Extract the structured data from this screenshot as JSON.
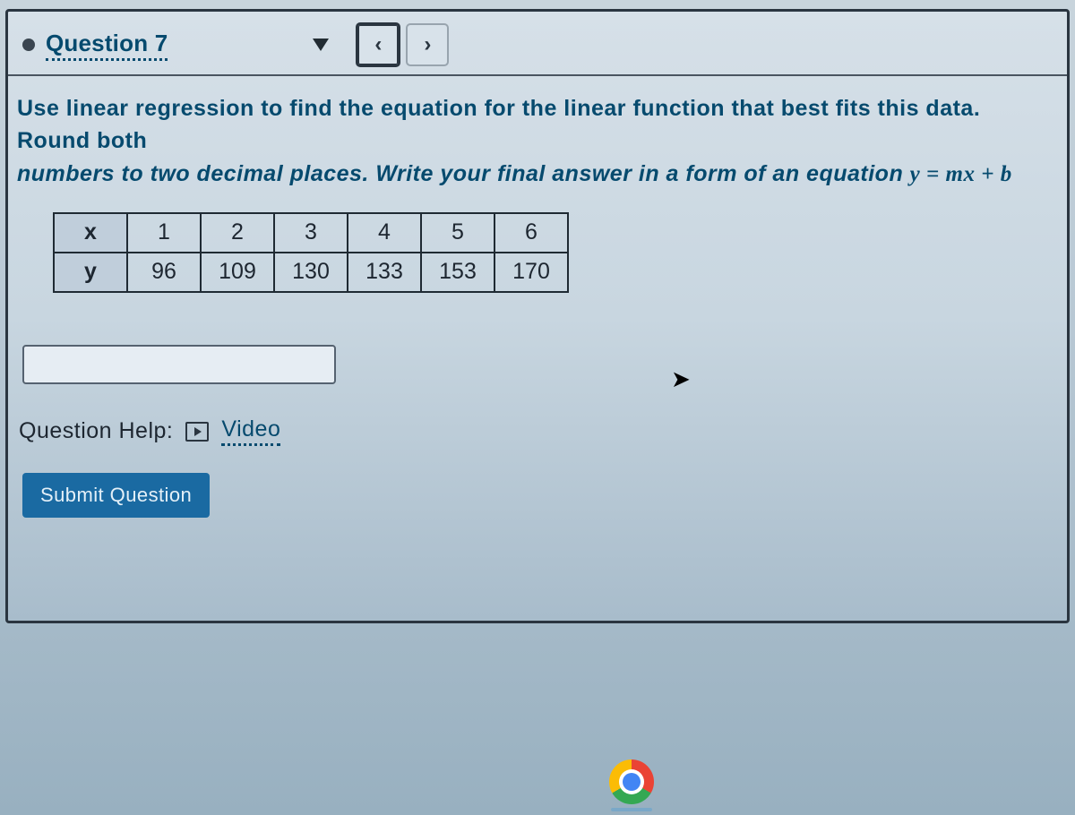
{
  "header": {
    "title": "Question 7",
    "prev_glyph": "‹",
    "next_glyph": "›"
  },
  "prompt": {
    "line1": "Use linear regression to find the equation for the linear function that best fits this data. Round both",
    "line2_a": "numbers to two decimal places. Write your final answer in a form of an equation ",
    "equation": "y = mx + b"
  },
  "table": {
    "row_labels": [
      "x",
      "y"
    ],
    "x": [
      "1",
      "2",
      "3",
      "4",
      "5",
      "6"
    ],
    "y": [
      "96",
      "109",
      "130",
      "133",
      "153",
      "170"
    ]
  },
  "answer": {
    "value": ""
  },
  "help": {
    "label": "Question Help:",
    "video": "Video"
  },
  "submit": {
    "label": "Submit Question"
  }
}
